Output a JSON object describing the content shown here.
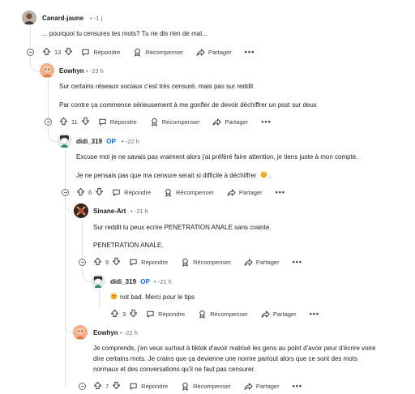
{
  "actions": {
    "reply": "Répondre",
    "reward": "Récompenser",
    "share": "Partager",
    "more": "•••"
  },
  "comments": [
    {
      "author": "Canard-jaune",
      "time": "• -1 j",
      "lines": [
        "... pourquoi tu censures tes mots? Tu ne dis rien de mal..."
      ],
      "votes": "13"
    },
    {
      "author": "Eowhyn",
      "time": "• -23 h",
      "lines": [
        "Sur certains réseaux sociaux c'est très censuré, mais pas sur reddit",
        "Par contre ça commence sérieusement à me gonfler de devoir déchiffrer un post sur deux"
      ],
      "votes": "11"
    },
    {
      "author": "didi_319",
      "op": "OP",
      "time": "• -22 h",
      "lines": [
        "Excuse moi je ne savais pas vraiment alors j'ai préféré faire attention, je tiens juste à mon compte.",
        "Je ne pensais pas que ma censure serait si difficile à déchiffrer"
      ],
      "votes": "6"
    },
    {
      "author": "Sinane-Art",
      "time": "• -21 h",
      "lines": [
        "Sur reddit tu peux ecrire PENETRATION ANALE sans crainte.",
        "PENETRATION ANALE."
      ],
      "votes": "9"
    },
    {
      "author": "didi_319",
      "op": "OP",
      "time": "• -21 h",
      "lines": [
        "not bad. Merci pour le tips"
      ],
      "votes": "3"
    },
    {
      "author": "Eowhyn",
      "time": "• -22 h",
      "lines": [
        "Je comprends, j'en veux surtout à tiktok d'avoir matrixé les gens au point d'avoir peur d'écrire voire",
        "dire certains mots. Je crains que ça devienne une norme partout alors que ce sont des mots",
        "normaux et des conversations qu'il ne faut pas censurer."
      ],
      "votes": "7"
    }
  ]
}
